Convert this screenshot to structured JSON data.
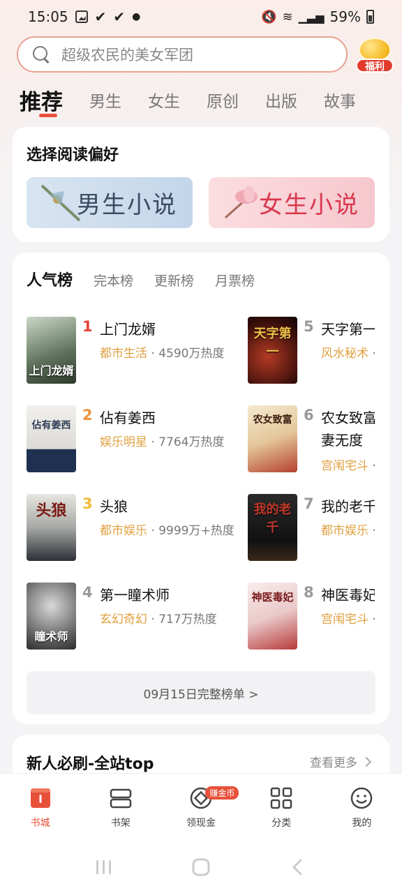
{
  "status": {
    "time": "15:05",
    "battery": "59%"
  },
  "search": {
    "placeholder": "超级农民的美女军团",
    "welfare_badge": "福利"
  },
  "tabs": [
    "推荐",
    "男生",
    "女生",
    "原创",
    "出版",
    "故事"
  ],
  "preference": {
    "title": "选择阅读偏好",
    "male": "男生小说",
    "female": "女生小说"
  },
  "ranking": {
    "tabs": [
      "人气榜",
      "完本榜",
      "更新榜",
      "月票榜"
    ],
    "books": [
      {
        "rank": "1",
        "title": "上门龙婿",
        "cover_text": "上门龙婿",
        "genre": "都市生活",
        "heat": "4590万热度",
        "rank_color": "#e8423a"
      },
      {
        "rank": "2",
        "title": "佔有姜西",
        "cover_text": "佔有姜西",
        "genre": "娱乐明星",
        "heat": "7764万热度",
        "rank_color": "#f0903a"
      },
      {
        "rank": "3",
        "title": "头狼",
        "cover_text": "头狼",
        "genre": "都市娱乐",
        "heat": "9999万+热度",
        "rank_color": "#f1bc3a"
      },
      {
        "rank": "4",
        "title": "第一瞳术师",
        "cover_text": "瞳术师",
        "genre": "玄幻奇幻",
        "heat": "717万热度",
        "rank_color": "#999999"
      },
      {
        "rank": "5",
        "title": "天字第一",
        "cover_text": "天字第一",
        "genre": "风水秘术",
        "heat": "",
        "rank_color": "#999999"
      },
      {
        "rank": "6",
        "title": "农女致富",
        "title2": "妻无度",
        "cover_text": "农女致富",
        "genre": "宫闱宅斗",
        "heat": "",
        "rank_color": "#999999"
      },
      {
        "rank": "7",
        "title": "我的老千",
        "cover_text": "我的老千",
        "genre": "都市娱乐",
        "heat": "",
        "rank_color": "#999999"
      },
      {
        "rank": "8",
        "title": "神医毒妃",
        "cover_text": "神医毒妃",
        "genre": "宫闱宅斗",
        "heat": "",
        "rank_color": "#999999"
      }
    ],
    "full_list": "09月15日完整榜单 >"
  },
  "newbie": {
    "title": "新人必刷-全站top",
    "see_more": "查看更多"
  },
  "bottom_nav": [
    {
      "label": "书城",
      "icon": "bookstore-icon"
    },
    {
      "label": "书架",
      "icon": "bookshelf-icon"
    },
    {
      "label": "领现金",
      "icon": "cash-icon",
      "badge": "赚金币"
    },
    {
      "label": "分类",
      "icon": "category-icon"
    },
    {
      "label": "我的",
      "icon": "profile-icon"
    }
  ],
  "colors": {
    "accent": "#e8503a",
    "genre": "#e0a040"
  }
}
